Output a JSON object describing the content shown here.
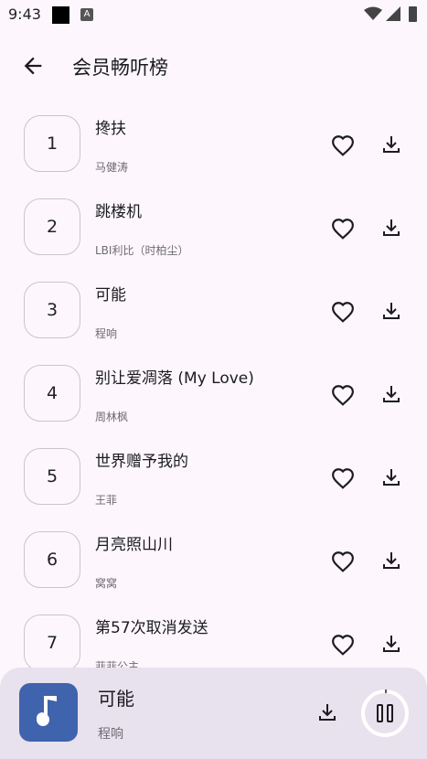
{
  "status": {
    "time": "9:43",
    "notif_badge": "A"
  },
  "header": {
    "title": "会员畅听榜"
  },
  "songs": [
    {
      "rank": "1",
      "title": "搀扶",
      "artist": "马健涛"
    },
    {
      "rank": "2",
      "title": "跳楼机",
      "artist": "LBI利比（时柏尘）"
    },
    {
      "rank": "3",
      "title": "可能",
      "artist": "程响"
    },
    {
      "rank": "4",
      "title": "别让爱凋落 (My Love)",
      "artist": "周林枫"
    },
    {
      "rank": "5",
      "title": "世界赠予我的",
      "artist": "王菲"
    },
    {
      "rank": "6",
      "title": "月亮照山川",
      "artist": "窝窝"
    },
    {
      "rank": "7",
      "title": "第57次取消发送",
      "artist": "菲菲公主"
    }
  ],
  "player": {
    "title": "可能",
    "artist": "程响",
    "cover_color": "#3f63ad"
  },
  "icons": {
    "back": "arrow-back-icon",
    "favorite": "heart-outline-icon",
    "download": "download-icon",
    "music": "music-note-icon",
    "pause": "pause-icon"
  }
}
